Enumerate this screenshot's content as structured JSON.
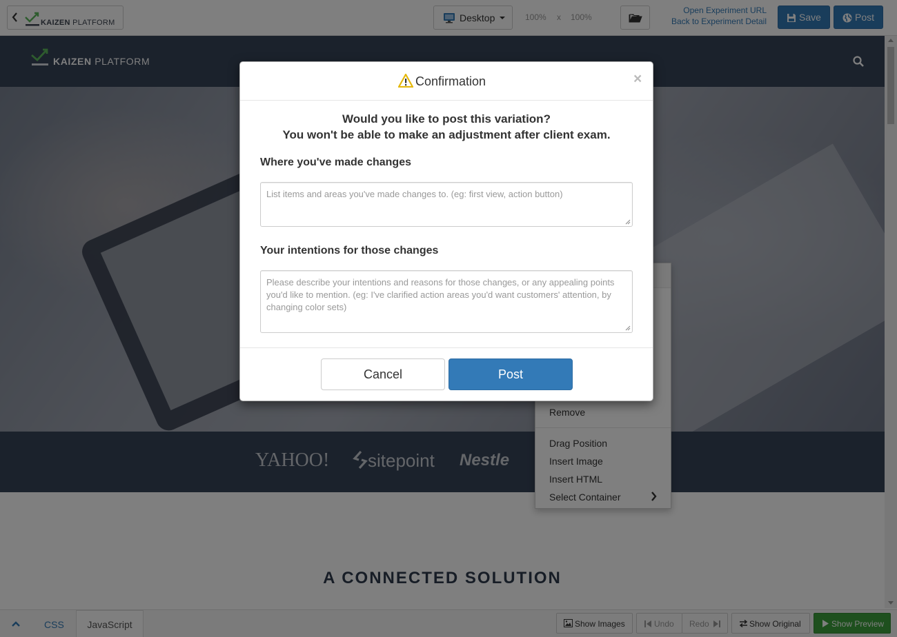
{
  "toolbar": {
    "brand_word": "KAIZEN",
    "brand_rest": "PLATFORM",
    "device": "Desktop",
    "zoom_w": "100%",
    "zoom_sep": "x",
    "zoom_h": "100%",
    "open_url_link": "Open Experiment URL",
    "back_link": "Back to Experiment Detail",
    "save_label": "Save",
    "post_label": "Post"
  },
  "site": {
    "brand_word": "KAIZEN",
    "brand_rest": "PLATFORM",
    "clients": [
      "YAHOO!",
      "sitepoint",
      "Nestle"
    ],
    "section_title": "A CONNECTED SOLUTION"
  },
  "context_menu": {
    "items": [
      "Remove",
      "Drag Position",
      "Insert Image",
      "Insert HTML",
      "Select Container"
    ]
  },
  "bottom": {
    "tab_css": "CSS",
    "tab_js": "JavaScript",
    "show_images": "Show Images",
    "undo": "Undo",
    "redo": "Redo",
    "show_original": "Show Original",
    "show_preview": "Show Preview"
  },
  "modal": {
    "title": "Confirmation",
    "close": "×",
    "question1": "Would you like to post this variation?",
    "question2": "You won't be able to make an adjustment after client exam.",
    "field1_label": "Where you've made changes",
    "field1_placeholder": "List items and areas you've made changes to. (eg: first view, action button)",
    "field2_label": "Your intentions for those changes",
    "field2_placeholder": "Please describe your intentions and reasons for those changes, or any appealing points you'd like to mention. (eg: I've clarified action areas you'd want customers' attention, by changing color sets)",
    "cancel_label": "Cancel",
    "post_label": "Post"
  },
  "colors": {
    "primary": "#337ab7",
    "success": "#3da13d",
    "site_nav": "#374459",
    "logo_green": "#5cb85c",
    "warning": "#e5b80b"
  }
}
